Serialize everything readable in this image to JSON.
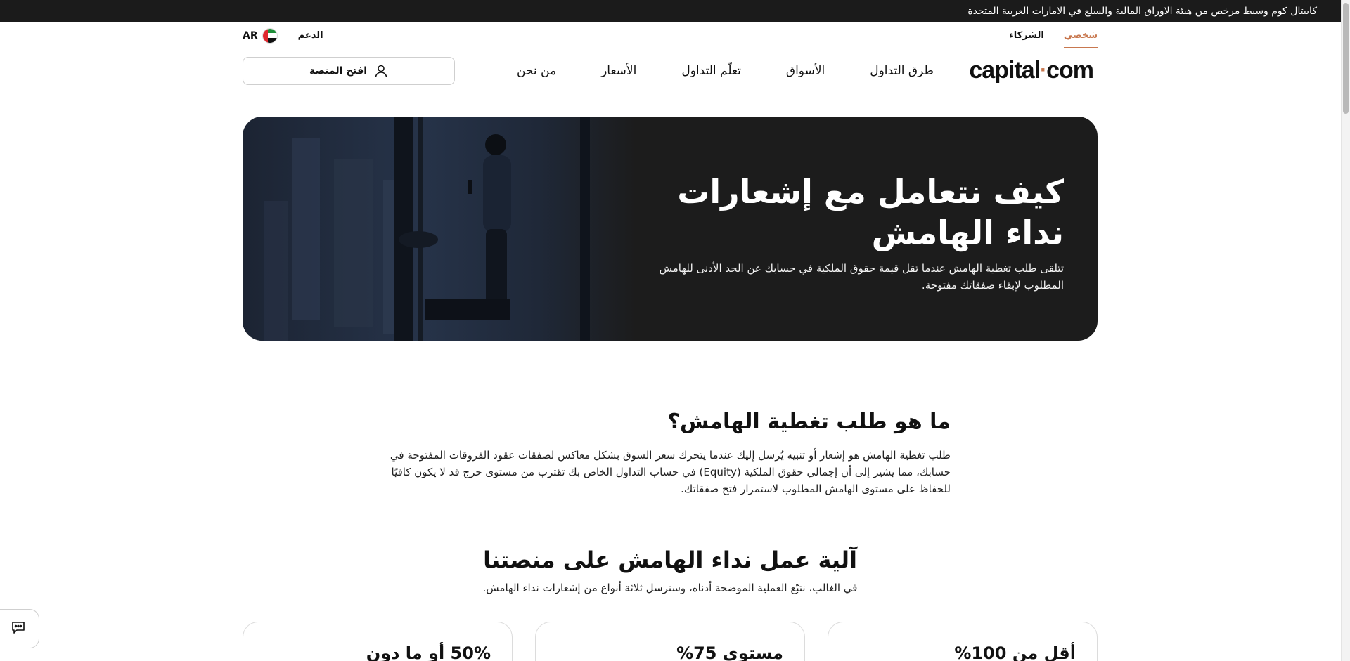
{
  "banner": {
    "text": "كابيتال كوم وسيط مرخص من هيئة الاوراق المالية والسلع في الامارات العربية المتحدة"
  },
  "utility_bar": {
    "tabs": [
      {
        "label": "شخصي",
        "active": true
      },
      {
        "label": "الشركاء",
        "active": false
      }
    ],
    "support_label": "الدعم",
    "language_code": "AR",
    "flag_icon": "uae-flag-icon"
  },
  "nav": {
    "logo_left": "capital",
    "logo_dot": "·",
    "logo_right": "com",
    "links": [
      "طرق التداول",
      "الأسواق",
      "تعلّم التداول",
      "الأسعار",
      "من نحن"
    ],
    "open_platform_label": "افتح المنصة",
    "open_platform_icon": "user-icon"
  },
  "hero": {
    "title": "كيف نتعامل مع إشعارات نداء الهامش",
    "subtitle": "تتلقى طلب تغطية الهامش عندما تقل قيمة حقوق الملكية في حسابك عن الحد الأدنى للهامش المطلوب لإبقاء صفقاتك مفتوحة."
  },
  "section_what": {
    "heading": "ما هو طلب تغطية الهامش؟",
    "body": "طلب تغطية الهامش هو إشعار أو تنبيه يُرسل إليك عندما يتحرك سعر السوق بشكل معاكس لصفقات عقود الفروقات المفتوحة في حسابك، مما يشير إلى أن إجمالي حقوق الملكية (Equity) في حساب التداول الخاص بك تقترب من مستوى حرج قد لا يكون كافيًا للحفاظ على مستوى الهامش المطلوب لاستمرار فتح صفقاتك."
  },
  "section_how": {
    "heading": "آلية عمل نداء الهامش على منصتنا",
    "subheading": "في الغالب، نتبّع العملية الموضحة أدناه، وسنرسل ثلاثة أنواع من إشعارات نداء الهامش."
  },
  "cards": [
    {
      "title": "أقل من 100%"
    },
    {
      "title": "مستوى 75%"
    },
    {
      "title": "50% أو ما دون"
    }
  ],
  "chat": {
    "icon": "chat-icon"
  },
  "colors": {
    "accent": "#c8784f",
    "banner_bg": "#1b1b1b",
    "hero_bg": "#1c1c1c"
  }
}
